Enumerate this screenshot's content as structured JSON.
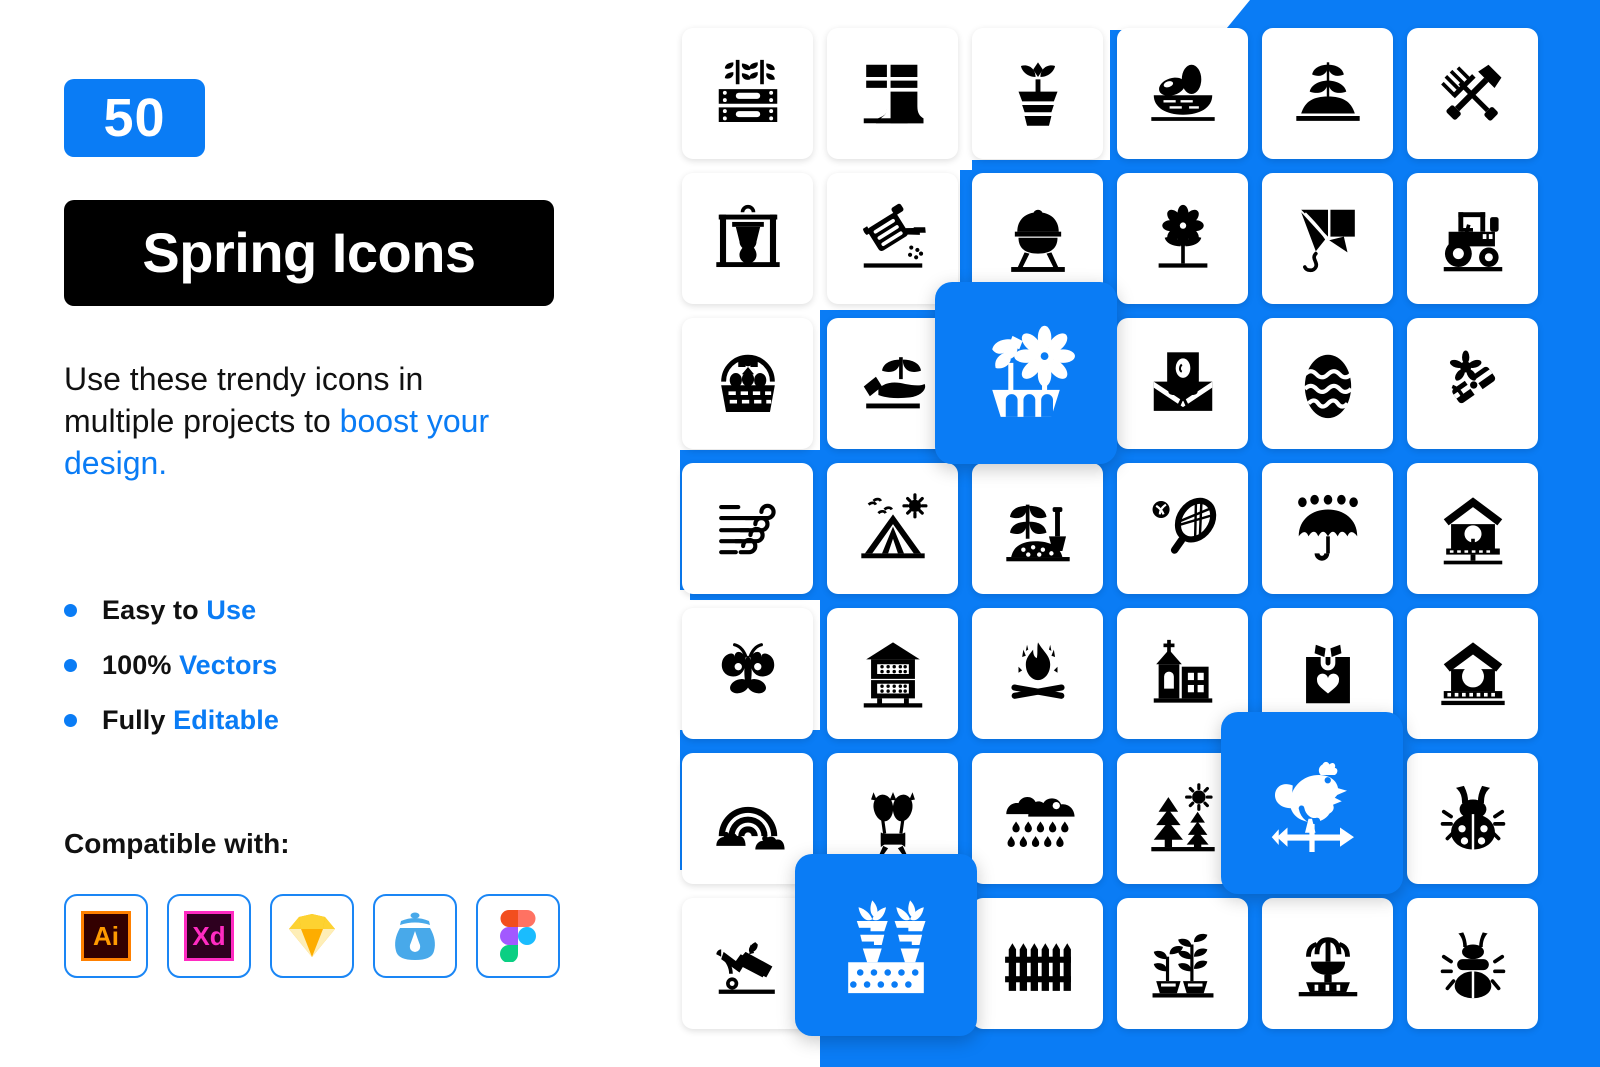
{
  "theme": {
    "accent_blue": "#0a7cf5",
    "black": "#000000",
    "white": "#ffffff"
  },
  "left": {
    "count_badge": "50",
    "title": "Spring Icons",
    "intro": {
      "line1_plain": "Use these trendy icons in",
      "line2_plain": "multiple projects to ",
      "line2_accent": "boost your",
      "line3_accent": "design."
    },
    "features": [
      {
        "plain": "Easy to ",
        "accent": "Use"
      },
      {
        "plain": "100% ",
        "accent": "Vectors"
      },
      {
        "plain": "Fully ",
        "accent": "Editable"
      }
    ],
    "compatible_heading": "Compatible with:",
    "apps": [
      {
        "name": "adobe-illustrator",
        "label": "Ai"
      },
      {
        "name": "adobe-xd",
        "label": "Xd"
      },
      {
        "name": "sketch",
        "label": ""
      },
      {
        "name": "invision-studio",
        "label": ""
      },
      {
        "name": "figma",
        "label": ""
      }
    ]
  },
  "grid": {
    "columns": 6,
    "rows": 7,
    "icons": [
      "seedling-crate-icon",
      "rain-boots-icon",
      "potted-plant-icon",
      "easter-egg-nest-icon",
      "sprout-in-soil-icon",
      "rake-and-shovel-icon",
      "campfire-pot-icon",
      "watering-can-icon",
      "bbq-grill-icon",
      "daisy-flower-icon",
      "kite-icon",
      "tractor-icon",
      "egg-basket-icon",
      "hand-holding-sprout-icon",
      "greenhouse-hand-icon",
      "egg-envelope-icon",
      "decorated-egg-icon",
      "gift-flower-icon",
      "wind-icon",
      "camping-tent-icon",
      "plant-with-shovel-icon",
      "tennis-racket-icon",
      "umbrella-rain-icon",
      "birdhouse-icon",
      "butterfly-icon",
      "bird-hotel-icon",
      "bonfire-icon",
      "church-icon",
      "gift-bag-heart-icon",
      "birdhouse-perch-icon",
      "rainbow-cloud-icon",
      "tulip-bouquet-icon",
      "rain-cloud-icon",
      "forest-sun-icon",
      "weathervane-rooster-icon",
      "ladybug-icon",
      "wheelbarrow-icon",
      "carrot-garden-icon",
      "picket-fence-icon",
      "potted-plants-icon",
      "fountain-icon",
      "beetle-icon"
    ],
    "highlighted": [
      {
        "name": "flower-planter-icon",
        "row": 3,
        "col": 3
      },
      {
        "name": "weathervane-rooster-icon",
        "row": 6,
        "col": 5
      },
      {
        "name": "carrot-garden-icon",
        "row": 7,
        "col": 2
      }
    ]
  }
}
